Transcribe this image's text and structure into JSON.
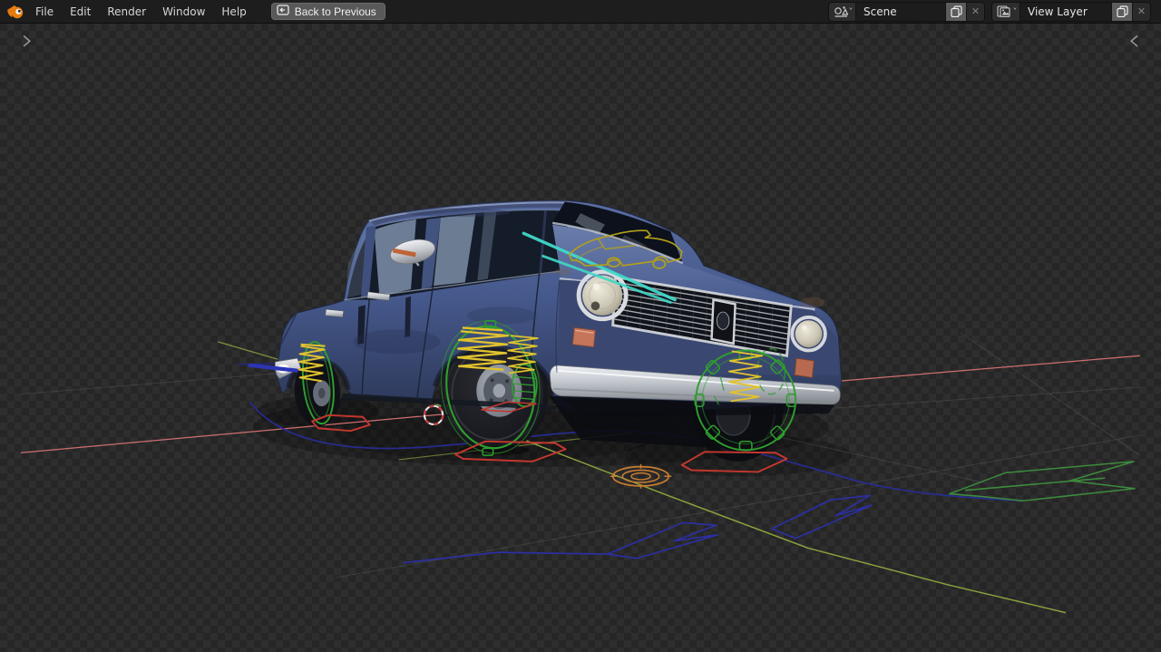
{
  "topbar": {
    "menus": [
      "File",
      "Edit",
      "Render",
      "Window",
      "Help"
    ],
    "back_button": "Back to Previous",
    "scene_selector": "Scene",
    "view_layer_selector": "View Layer"
  },
  "icons": {
    "scene_dropdown_chevron": "˅",
    "view_layer_dropdown_chevron": "˅",
    "scene_close_x": "✕",
    "view_layer_close_x": "✕"
  },
  "viewport": {
    "scene_object": "blue vintage sedan 3D model with armature rig controls on transparent checker background",
    "rig_colors": {
      "wheel_circles": "#2f9e2f",
      "suspension_springs": "#e0c22e",
      "ground_targets": "#c3372f",
      "paths_and_arrows": "#2b2fa6",
      "root_circles": "#c97c2e",
      "wiper_controls": "#3fd8c7",
      "hood_body_control": "#b3a019",
      "x_axis_line": "#cf6f6f",
      "y_axis_line": "#8aa23f"
    }
  },
  "theme": {
    "topbar_bg": "#1d1d1d",
    "checker_dark": "#262626",
    "checker_light": "#2e2e2e",
    "accent_orange": "#e87d0d",
    "back_button_bg": "#595959",
    "text_color": "#d9d9d9",
    "car_body_blue": "#46598c"
  }
}
